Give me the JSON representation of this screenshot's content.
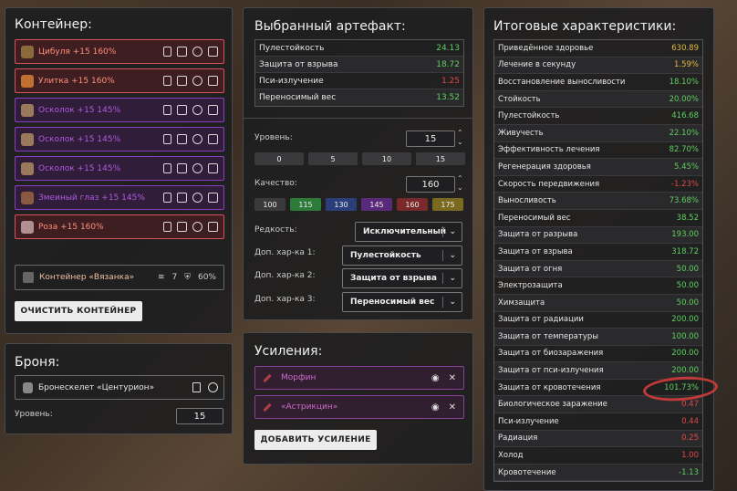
{
  "container": {
    "title": "Контейнер:",
    "slots": [
      {
        "label": "Цибуля +15 160%",
        "style": "red"
      },
      {
        "label": "Улитка +15 160%",
        "style": "red"
      },
      {
        "label": "Осколок +15 145%",
        "style": "purple"
      },
      {
        "label": "Осколок +15 145%",
        "style": "purple"
      },
      {
        "label": "Осколок +15 145%",
        "style": "purple"
      },
      {
        "label": "Змеиный глаз +15 145%",
        "style": "purple"
      },
      {
        "label": "Роза +15 160%",
        "style": "red"
      }
    ],
    "box_label": "Контейнер «Вязанка»",
    "box_capacity": "7",
    "box_protection": "60%",
    "clear_label": "ОЧИСТИТЬ КОНТЕЙНЕР"
  },
  "armor": {
    "title": "Броня:",
    "item_label": "Бронескелет «Центурион»",
    "level_label": "Уровень:",
    "level_value": "15"
  },
  "artifact": {
    "title": "Выбранный артефакт:",
    "stats": [
      {
        "name": "Пулестойкость",
        "value": "24.13",
        "color": "green"
      },
      {
        "name": "Защита от взрыва",
        "value": "18.72",
        "color": "green"
      },
      {
        "name": "Пси-излучение",
        "value": "1.25",
        "color": "red"
      },
      {
        "name": "Переносимый вес",
        "value": "13.52",
        "color": "green"
      }
    ],
    "level_label": "Уровень:",
    "level_value": "15",
    "level_presets": [
      "0",
      "5",
      "10",
      "15"
    ],
    "quality_label": "Качество:",
    "quality_value": "160",
    "quality_presets": [
      {
        "label": "100",
        "color": "#3a3a3c"
      },
      {
        "label": "115",
        "color": "#2e7a3a"
      },
      {
        "label": "130",
        "color": "#2a3e7a"
      },
      {
        "label": "145",
        "color": "#5a2a7a"
      },
      {
        "label": "160",
        "color": "#7a2a2a"
      },
      {
        "label": "175",
        "color": "#7a6a20"
      }
    ],
    "rarity_label": "Редкость:",
    "rarity_value": "Исключительный",
    "extra1_label": "Доп. хар-ка 1:",
    "extra1_value": "Пулестойкость",
    "extra2_label": "Доп. хар-ка 2:",
    "extra2_value": "Защита от взрыва",
    "extra3_label": "Доп. хар-ка 3:",
    "extra3_value": "Переносимый вес"
  },
  "boosts": {
    "title": "Усиления:",
    "items": [
      {
        "label": "Морфин"
      },
      {
        "label": "«Астрикцин»"
      }
    ],
    "add_label": "ДОБАВИТЬ УСИЛЕНИЕ"
  },
  "totals": {
    "title": "Итоговые характеристики:",
    "rows": [
      {
        "name": "Приведённое здоровье",
        "value": "630.89",
        "color": "yellow"
      },
      {
        "name": "Лечение в секунду",
        "value": "1.59%",
        "color": "yellow"
      },
      {
        "name": "Восстановление выносливости",
        "value": "18.10%",
        "color": "green"
      },
      {
        "name": "Стойкость",
        "value": "20.00%",
        "color": "green"
      },
      {
        "name": "Пулестойкость",
        "value": "416.68",
        "color": "green"
      },
      {
        "name": "Живучесть",
        "value": "22.10%",
        "color": "green"
      },
      {
        "name": "Эффективность лечения",
        "value": "82.70%",
        "color": "green"
      },
      {
        "name": "Регенерация здоровья",
        "value": "5.45%",
        "color": "green"
      },
      {
        "name": "Скорость передвижения",
        "value": "-1.23%",
        "color": "red"
      },
      {
        "name": "Выносливость",
        "value": "73.68%",
        "color": "green"
      },
      {
        "name": "Переносимый вес",
        "value": "38.52",
        "color": "green"
      },
      {
        "name": "Защита от разрыва",
        "value": "193.00",
        "color": "green"
      },
      {
        "name": "Защита от взрыва",
        "value": "318.72",
        "color": "green"
      },
      {
        "name": "Защита от огня",
        "value": "50.00",
        "color": "green"
      },
      {
        "name": "Электрозащита",
        "value": "50.00",
        "color": "green"
      },
      {
        "name": "Химзащита",
        "value": "50.00",
        "color": "green"
      },
      {
        "name": "Защита от радиации",
        "value": "200.00",
        "color": "green"
      },
      {
        "name": "Защита от температуры",
        "value": "100.00",
        "color": "green"
      },
      {
        "name": "Защита от биозаражения",
        "value": "200.00",
        "color": "green"
      },
      {
        "name": "Защита от пси-излучения",
        "value": "200.00",
        "color": "green"
      },
      {
        "name": "Защита от кровотечения",
        "value": "101.73%",
        "color": "green"
      },
      {
        "name": "Биологическое заражение",
        "value": "0.47",
        "color": "red"
      },
      {
        "name": "Пси-излучение",
        "value": "0.44",
        "color": "red"
      },
      {
        "name": "Радиация",
        "value": "0.25",
        "color": "red"
      },
      {
        "name": "Холод",
        "value": "1.00",
        "color": "red"
      },
      {
        "name": "Кровотечение",
        "value": "-1.13",
        "color": "green"
      }
    ]
  }
}
